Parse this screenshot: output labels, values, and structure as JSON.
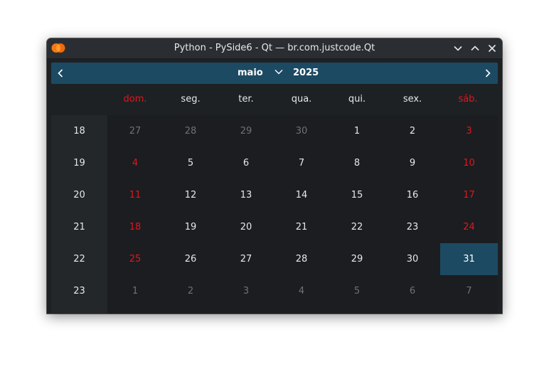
{
  "window": {
    "title": "Python - PySide6 - Qt — br.com.justcode.Qt"
  },
  "colors": {
    "selection": "#1d4a63",
    "weekend": "#e0161f",
    "other_month": "#6e7276",
    "text": "#e6e8ea"
  },
  "nav": {
    "month": "maio",
    "year": "2025"
  },
  "weekdays": [
    "dom.",
    "seg.",
    "ter.",
    "qua.",
    "qui.",
    "sex.",
    "sáb."
  ],
  "weeks": [
    {
      "number": "18",
      "days": [
        "27",
        "28",
        "29",
        "30",
        "1",
        "2",
        "3"
      ]
    },
    {
      "number": "19",
      "days": [
        "4",
        "5",
        "6",
        "7",
        "8",
        "9",
        "10"
      ]
    },
    {
      "number": "20",
      "days": [
        "11",
        "12",
        "13",
        "14",
        "15",
        "16",
        "17"
      ]
    },
    {
      "number": "21",
      "days": [
        "18",
        "19",
        "20",
        "21",
        "22",
        "23",
        "24"
      ]
    },
    {
      "number": "22",
      "days": [
        "25",
        "26",
        "27",
        "28",
        "29",
        "30",
        "31"
      ]
    },
    {
      "number": "23",
      "days": [
        "1",
        "2",
        "3",
        "4",
        "5",
        "6",
        "7"
      ]
    }
  ],
  "selected_day": "31"
}
